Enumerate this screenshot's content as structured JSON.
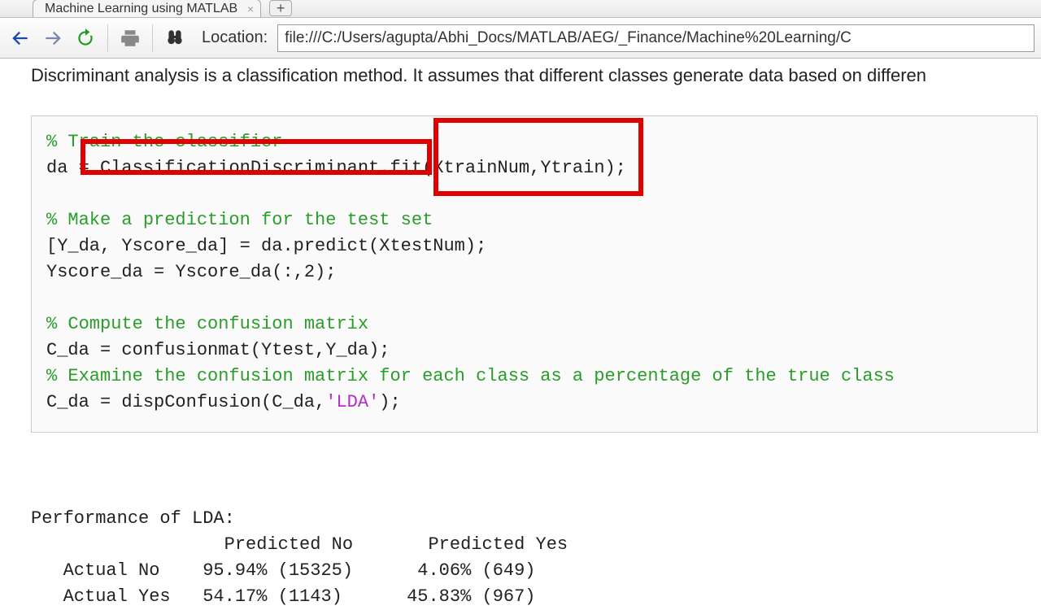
{
  "tab": {
    "title": "Machine Learning using MATLAB"
  },
  "toolbar": {
    "location_label": "Location:",
    "location_value": "file:///C:/Users/agupta/Abhi_Docs/MATLAB/AEG/_Finance/Machine%20Learning/C"
  },
  "intro": "Discriminant analysis is a classification method. It assumes that different classes generate data based on differen",
  "code": {
    "c1": "% Train the classifier",
    "l1a": "da = ",
    "l1b": "ClassificationDiscriminant.fit",
    "l1c": "(XtrainNum,Ytrain)",
    "l1d": ";",
    "c2": "% Make a prediction for the test set",
    "l2": "[Y_da, Yscore_da] = da.predict(XtestNum);",
    "l3": "Yscore_da = Yscore_da(:,2);",
    "c3": "% Compute the confusion matrix",
    "l4": "C_da = confusionmat(Ytest,Y_da);",
    "c4": "% Examine the confusion matrix for each class as a percentage of the true class",
    "l5a": "C_da = dispConfusion(C_da,",
    "l5b": "'LDA'",
    "l5c": ");"
  },
  "output": {
    "title": "Performance of LDA:",
    "header": "                  Predicted No       Predicted Yes",
    "row1": "   Actual No    95.94% (15325)      4.06% (649)",
    "row2": "   Actual Yes   54.17% (1143)      45.83% (967)"
  },
  "chart_data": {
    "type": "table",
    "title": "Performance of LDA:",
    "columns": [
      "",
      "Predicted No",
      "Predicted Yes"
    ],
    "rows": [
      {
        "label": "Actual No",
        "pred_no_pct": 95.94,
        "pred_no_count": 15325,
        "pred_yes_pct": 4.06,
        "pred_yes_count": 649
      },
      {
        "label": "Actual Yes",
        "pred_no_pct": 54.17,
        "pred_no_count": 1143,
        "pred_yes_pct": 45.83,
        "pred_yes_count": 967
      }
    ]
  }
}
